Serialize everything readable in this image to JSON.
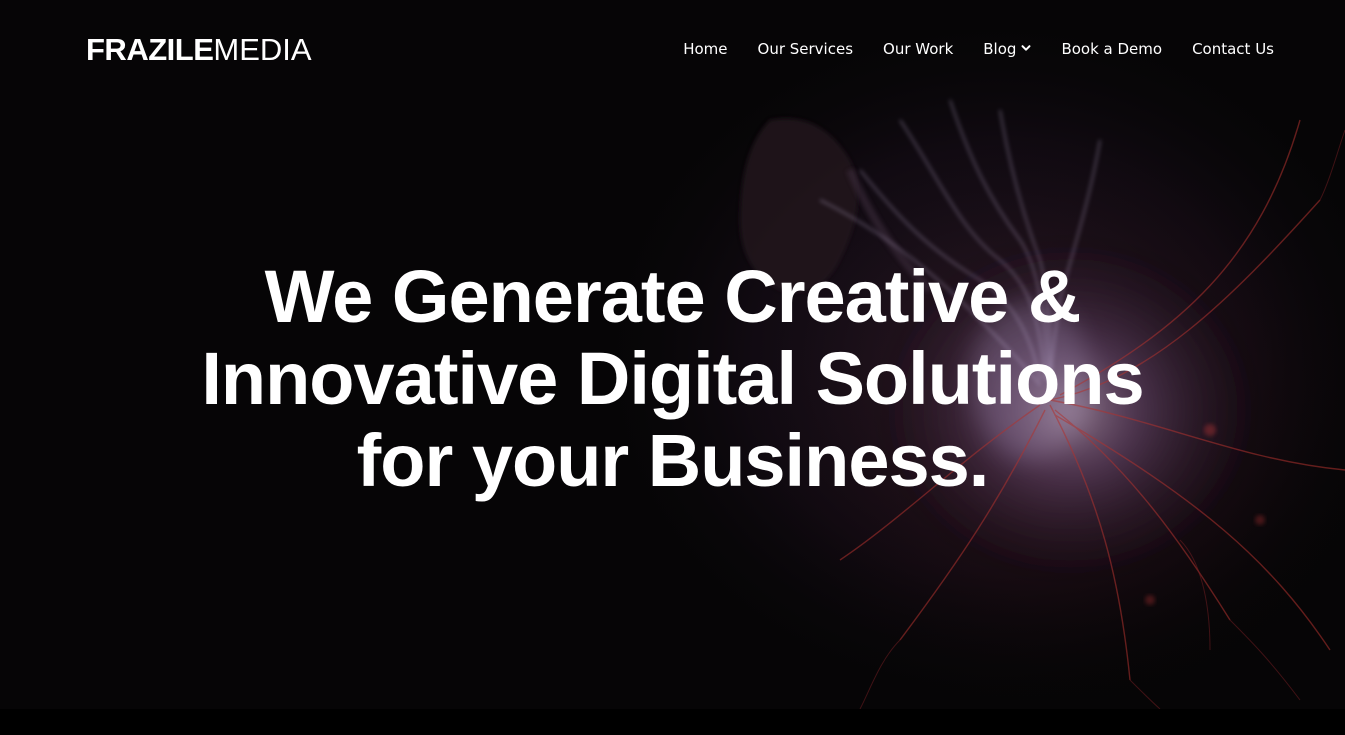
{
  "brand": {
    "logo_bold": "FRAZILE",
    "logo_light": "MEDIA"
  },
  "nav": {
    "items": [
      {
        "label": "Home"
      },
      {
        "label": "Our Services"
      },
      {
        "label": "Our Work"
      },
      {
        "label": "Blog",
        "icon": "chevron-down-icon"
      },
      {
        "label": "Book a Demo"
      },
      {
        "label": "Contact Us"
      }
    ]
  },
  "hero": {
    "headline_lines": [
      "We Generate Creative &",
      "Innovative Digital Solutions",
      "for your Business."
    ],
    "background_image": "plasma-ball-photo"
  },
  "colors": {
    "background": "#000000",
    "text": "#ffffff",
    "plasma_glow": "#c8b6e6",
    "plasma_tendrils": "#b0322e"
  }
}
